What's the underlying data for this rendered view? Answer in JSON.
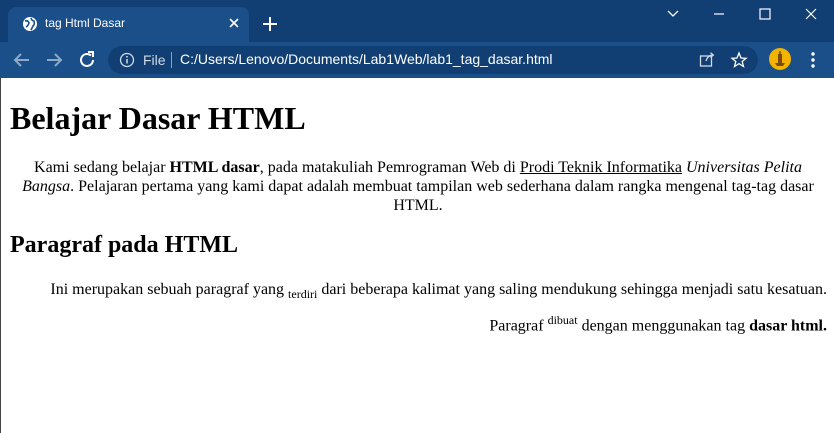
{
  "browser": {
    "tab_title": "tag Html Dasar",
    "scheme_label": "File",
    "url": "C:/Users/Lenovo/Documents/Lab1Web/lab1_tag_dasar.html",
    "icons": {
      "favicon": "globe-icon",
      "tab_close": "close-icon",
      "new_tab": "plus-icon",
      "back": "back-arrow-icon",
      "forward": "forward-arrow-icon",
      "reload": "reload-icon",
      "info": "info-icon",
      "share": "share-icon",
      "bookmark": "star-icon",
      "profile": "avatar",
      "menu": "kebab-menu-icon",
      "tab_search": "chevron-down-icon",
      "minimize": "minimize-icon",
      "maximize": "maximize-icon",
      "close_window": "close-icon"
    },
    "colors": {
      "titlebar": "#123f73",
      "toolbar": "#1b4f8a",
      "omnibox": "#123f73",
      "profile": "#f3b400"
    }
  },
  "page": {
    "heading": "Belajar Dasar HTML",
    "intro": {
      "t1": "Kami sedang belajar ",
      "bold": "HTML dasar",
      "t2": ", pada matakuliah Pemrograman Web di ",
      "link": "Prodi Teknik Informatika",
      "t3": " ",
      "italic": "Universitas Pelita Bangsa",
      "t4": ". Pelajaran pertama yang kami dapat adalah membuat tampilan web sederhana dalam rangka mengenal tag-tag dasar HTML."
    },
    "subheading": "Paragraf pada HTML",
    "paragraph": {
      "t1": "Ini merupakan sebuah paragraf yang ",
      "sub": "terdiri",
      "t2": " dari beberapa kalimat yang saling mendukung sehingga menjadi satu kesatuan. Paragraf ",
      "sup": "dibuat",
      "t3": " dengan menggunakan tag ",
      "bold": "dasar html."
    }
  }
}
